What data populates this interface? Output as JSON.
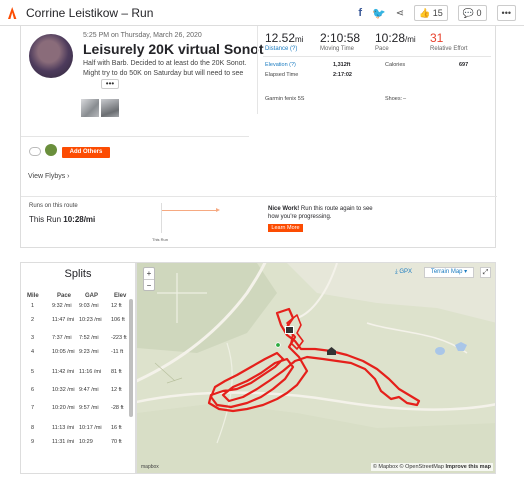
{
  "header": {
    "title": "Corrine Leistikow – Run",
    "share_icons": [
      "facebook-icon",
      "twitter-icon",
      "share-icon"
    ],
    "kudos_count": "15",
    "comment_count": "0",
    "more_label": "•••"
  },
  "activity": {
    "date": "5:25 PM on Thursday, March 26, 2020",
    "name": "Leisurely 20K virtual Sonot",
    "description": "Half with Barb. Decided to at least do the 20K Sonot. Might try to do 50K on Saturday but will need to see",
    "more_button": "•••",
    "stats": [
      {
        "value": "12.52",
        "unit": "mi",
        "label": "Distance (?)"
      },
      {
        "value": "2:10:58",
        "unit": "",
        "label": "Moving Time"
      },
      {
        "value": "10:28",
        "unit": "/mi",
        "label": "Pace"
      },
      {
        "value": "31",
        "unit": "",
        "label": "Relative Effort"
      }
    ],
    "sub_stats": {
      "elevation_label": "Elevation (?)",
      "elevation_value": "1,312ft",
      "calories_label": "Calories",
      "calories_value": "697",
      "elapsed_label": "Elapsed Time",
      "elapsed_value": "2:17:02",
      "device": "Garmin fenix 5S",
      "shoes_label": "Shoes:",
      "shoes_value": "–"
    },
    "add_others": "Add Others",
    "view_flybys": "View Flybys"
  },
  "compare": {
    "runs_on_route": "Runs on this route",
    "this_run_label": "This Run",
    "this_run_value": "10:28/mi",
    "marker_label": "This Run",
    "nice_work_bold": "Nice Work!",
    "nice_work_text": " Run this route again to see how you're progressing.",
    "learn_more": "Learn More"
  },
  "splits": {
    "title": "Splits",
    "columns": [
      "Mile",
      "Pace",
      "GAP",
      "Elev"
    ],
    "rows": [
      {
        "mile": "1",
        "pace": "9:32 /mi",
        "gap": "9:03 /mi",
        "elev": "12 ft"
      },
      {
        "mile": "2",
        "pace": "11:47 /mi",
        "gap": "10:23 /mi",
        "elev": "106 ft"
      },
      {
        "mile": "3",
        "pace": "7:37 /mi",
        "gap": "7:52 /mi",
        "elev": "-223 ft"
      },
      {
        "mile": "4",
        "pace": "10:05 /mi",
        "gap": "9:23 /mi",
        "elev": "-11 ft"
      },
      {
        "mile": "5",
        "pace": "11:42 /mi",
        "gap": "11:16 /mi",
        "elev": "81 ft"
      },
      {
        "mile": "6",
        "pace": "10:32 /mi",
        "gap": "9:47 /mi",
        "elev": "12 ft"
      },
      {
        "mile": "7",
        "pace": "10:20 /mi",
        "gap": "9:57 /mi",
        "elev": "-28 ft"
      },
      {
        "mile": "8",
        "pace": "11:13 /mi",
        "gap": "10:17 /mi",
        "elev": "16 ft"
      },
      {
        "mile": "9",
        "pace": "11:31 /mi",
        "gap": "10:29",
        "elev": "70 ft"
      }
    ]
  },
  "map": {
    "zoom_in": "+",
    "zoom_out": "−",
    "gpx_label": "GPX",
    "terrain_label": "Terrain Map ▾",
    "fullscreen": "⤢",
    "attribution_mapbox": "© Mapbox",
    "attribution_osm": "© OpenStreetMap",
    "improve": "Improve this map",
    "logo": "mapbox",
    "route_color": "#e5201b",
    "icons": [
      "mailbox-icon",
      "house-icon"
    ]
  }
}
